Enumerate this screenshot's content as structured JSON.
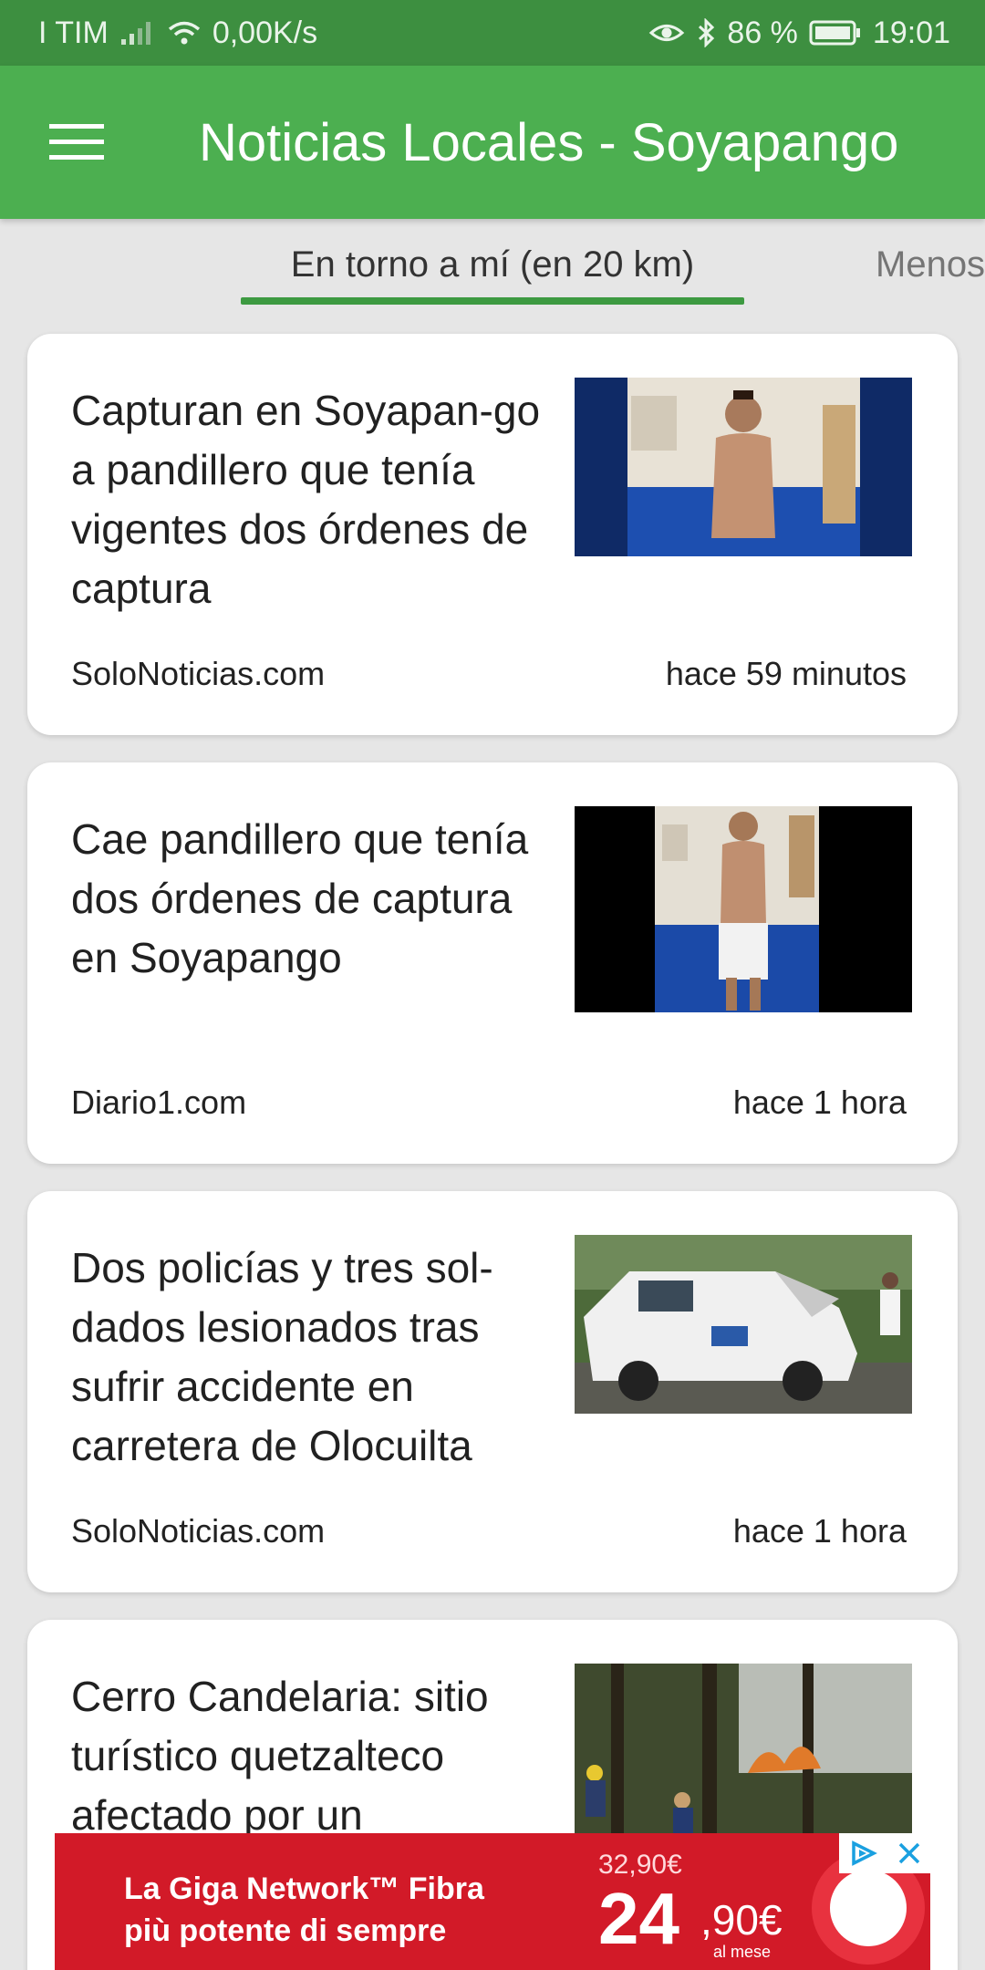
{
  "status_bar": {
    "carrier": "I TIM",
    "speed": "0,00K/s",
    "battery": "86 %",
    "time": "19:01"
  },
  "app_bar": {
    "title": "Noticias Locales - Soyapango"
  },
  "tabs": [
    {
      "label": "En torno a mí (en 20 km)",
      "selected": true
    },
    {
      "label": "Menos"
    }
  ],
  "articles": [
    {
      "title": "Capturan en Soyapan-go a pandillero que tenía vigentes dos órdenes de captura",
      "source": "SoloNoticias.com",
      "time": "hace 59 minutos",
      "thumbnail": "shirtless-man-standing-by-wall-photo"
    },
    {
      "title": "Cae pandillero que tenía dos órdenes de captura en Soyapango",
      "source": "Diario1.com",
      "time": "hace 1 hora",
      "thumbnail": "man-in-white-shorts-photo"
    },
    {
      "title": "Dos policías y tres sol-dados lesionados tras sufrir accidente en carretera de Olocuilta",
      "source": "SoloNoticias.com",
      "time": "hace 1 hora",
      "thumbnail": "crashed-police-pickup-photo"
    },
    {
      "title": "Cerro Candelaria: sitio turístico quetzalteco afectado por un",
      "source": "",
      "time": "",
      "thumbnail": "forest-fire-photo"
    }
  ],
  "ad": {
    "line1": "La Giga Network™ Fibra",
    "line2": "più potente di sempre",
    "old_price": "32,90€",
    "price_whole": "24",
    "price_decimal": ",90€",
    "price_sub": "al mese"
  },
  "colors": {
    "status_bar": "#3d8f40",
    "app_bar": "#4caf50",
    "tab_indicator": "#3d9a41",
    "background": "#e6e6e6",
    "ad": "#d21a28"
  }
}
